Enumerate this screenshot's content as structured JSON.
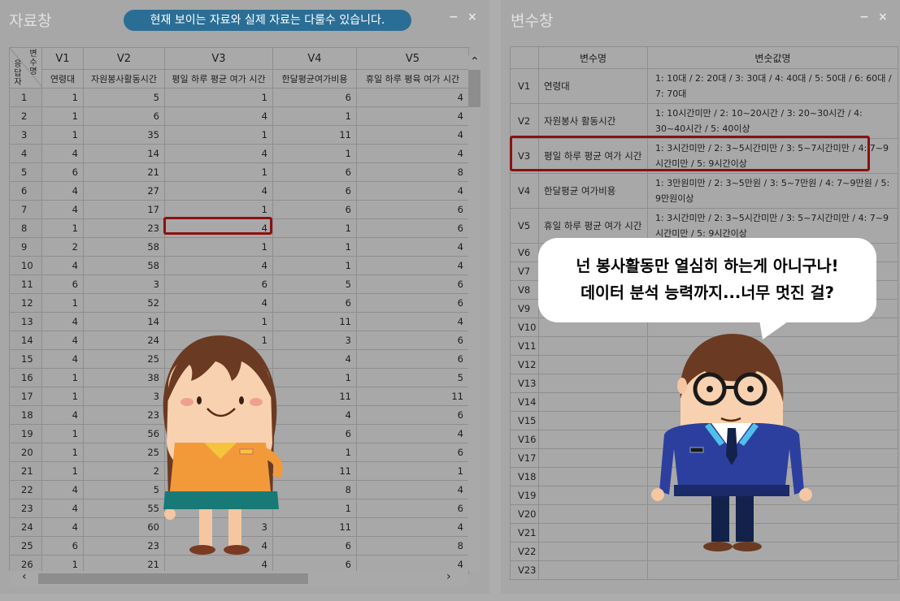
{
  "left_window": {
    "title": "자료창",
    "banner": "현재 보이는 자료와 실제 자료는 다룰수 있습니다.",
    "minimize": "−",
    "close": "×",
    "corner_top": "변수명",
    "corner_bottom": "응답자",
    "columns": [
      {
        "var": "V1",
        "name": "연령대"
      },
      {
        "var": "V2",
        "name": "자원봉사활동시간"
      },
      {
        "var": "V3",
        "name": "평일 하루 평균 여가 시간"
      },
      {
        "var": "V4",
        "name": "한달평균여가비용"
      },
      {
        "var": "V5",
        "name": "휴일 하루 평육 여가 시간"
      }
    ],
    "rows": [
      [
        "1",
        "1",
        "5",
        "1",
        "6",
        "4"
      ],
      [
        "2",
        "1",
        "6",
        "4",
        "1",
        "4"
      ],
      [
        "3",
        "1",
        "35",
        "1",
        "11",
        "4"
      ],
      [
        "4",
        "4",
        "14",
        "4",
        "1",
        "4"
      ],
      [
        "5",
        "6",
        "21",
        "1",
        "6",
        "8"
      ],
      [
        "6",
        "4",
        "27",
        "4",
        "6",
        "4"
      ],
      [
        "7",
        "4",
        "17",
        "1",
        "6",
        "6"
      ],
      [
        "8",
        "1",
        "23",
        "4",
        "1",
        "6"
      ],
      [
        "9",
        "2",
        "58",
        "1",
        "1",
        "4"
      ],
      [
        "10",
        "4",
        "58",
        "4",
        "1",
        "4"
      ],
      [
        "11",
        "6",
        "3",
        "6",
        "5",
        "6"
      ],
      [
        "12",
        "1",
        "52",
        "4",
        "6",
        "6"
      ],
      [
        "13",
        "4",
        "14",
        "1",
        "11",
        "4"
      ],
      [
        "14",
        "4",
        "24",
        "1",
        "3",
        "6"
      ],
      [
        "15",
        "4",
        "25",
        "",
        "4",
        "6"
      ],
      [
        "16",
        "1",
        "38",
        "",
        "1",
        "5"
      ],
      [
        "17",
        "1",
        "3",
        "",
        "11",
        "11"
      ],
      [
        "18",
        "4",
        "23",
        "",
        "4",
        "6"
      ],
      [
        "19",
        "1",
        "56",
        "",
        "6",
        "4"
      ],
      [
        "20",
        "1",
        "25",
        "",
        "1",
        "6"
      ],
      [
        "21",
        "1",
        "2",
        "",
        "11",
        "1"
      ],
      [
        "22",
        "4",
        "5",
        "",
        "8",
        "4"
      ],
      [
        "23",
        "4",
        "55",
        "",
        "1",
        "6"
      ],
      [
        "24",
        "4",
        "60",
        "3",
        "11",
        "4"
      ],
      [
        "25",
        "6",
        "23",
        "4",
        "6",
        "8"
      ],
      [
        "26",
        "1",
        "21",
        "4",
        "6",
        "4"
      ]
    ]
  },
  "right_window": {
    "title": "변수창",
    "minimize": "−",
    "close": "×",
    "headers": [
      "변수명",
      "변숫값명"
    ],
    "vars": [
      {
        "id": "V1",
        "name": "연령대",
        "values": "1: 10대 / 2: 20대 / 3: 30대 / 4: 40대 / 5: 50대 / 6: 60대 / 7: 70대"
      },
      {
        "id": "V2",
        "name": "자원봉사 활동시간",
        "values": "1: 10시간미만 / 2: 10~20시간 / 3: 20~30시간 / 4: 30~40시간 / 5: 40이상"
      },
      {
        "id": "V3",
        "name": "평일 하루 평균 여가 시간",
        "values": "1: 3시간미만 / 2: 3~5시간미만 / 3: 5~7시간미만 / 4: 7~9시간미만 / 5: 9시간이상"
      },
      {
        "id": "V4",
        "name": "한달평균 여가비용",
        "values": "1: 3만원미만 / 2: 3~5만원 / 3: 5~7만원 / 4: 7~9만원 / 5: 9만원이상"
      },
      {
        "id": "V5",
        "name": "휴일 하루 평균 여가 시간",
        "values": "1: 3시간미만 / 2: 3~5시간미만 / 3: 5~7시간미만 / 4: 7~9시간미만 / 5: 9시간이상"
      },
      {
        "id": "V6",
        "name": "",
        "values": ""
      },
      {
        "id": "V7",
        "name": "",
        "values": ""
      },
      {
        "id": "V8",
        "name": "",
        "values": ""
      },
      {
        "id": "V9",
        "name": "",
        "values": ""
      },
      {
        "id": "V10",
        "name": "",
        "values": ""
      },
      {
        "id": "V11",
        "name": "",
        "values": ""
      },
      {
        "id": "V12",
        "name": "",
        "values": ""
      },
      {
        "id": "V13",
        "name": "",
        "values": ""
      },
      {
        "id": "V14",
        "name": "",
        "values": ""
      },
      {
        "id": "V15",
        "name": "",
        "values": ""
      },
      {
        "id": "V16",
        "name": "",
        "values": ""
      },
      {
        "id": "V17",
        "name": "",
        "values": ""
      },
      {
        "id": "V18",
        "name": "",
        "values": ""
      },
      {
        "id": "V19",
        "name": "",
        "values": ""
      },
      {
        "id": "V20",
        "name": "",
        "values": ""
      },
      {
        "id": "V21",
        "name": "",
        "values": ""
      },
      {
        "id": "V22",
        "name": "",
        "values": ""
      },
      {
        "id": "V23",
        "name": "",
        "values": ""
      }
    ]
  },
  "speech_bubble": {
    "line1": "넌 봉사활동만 열심히 하는게 아니구나!",
    "line2": "데이터 분석 능력까지...너무 멋진 걸?"
  },
  "colors": {
    "highlight": "#8c1010",
    "banner": "#2a6e96",
    "overlay_gray": "#a7a7a7"
  }
}
